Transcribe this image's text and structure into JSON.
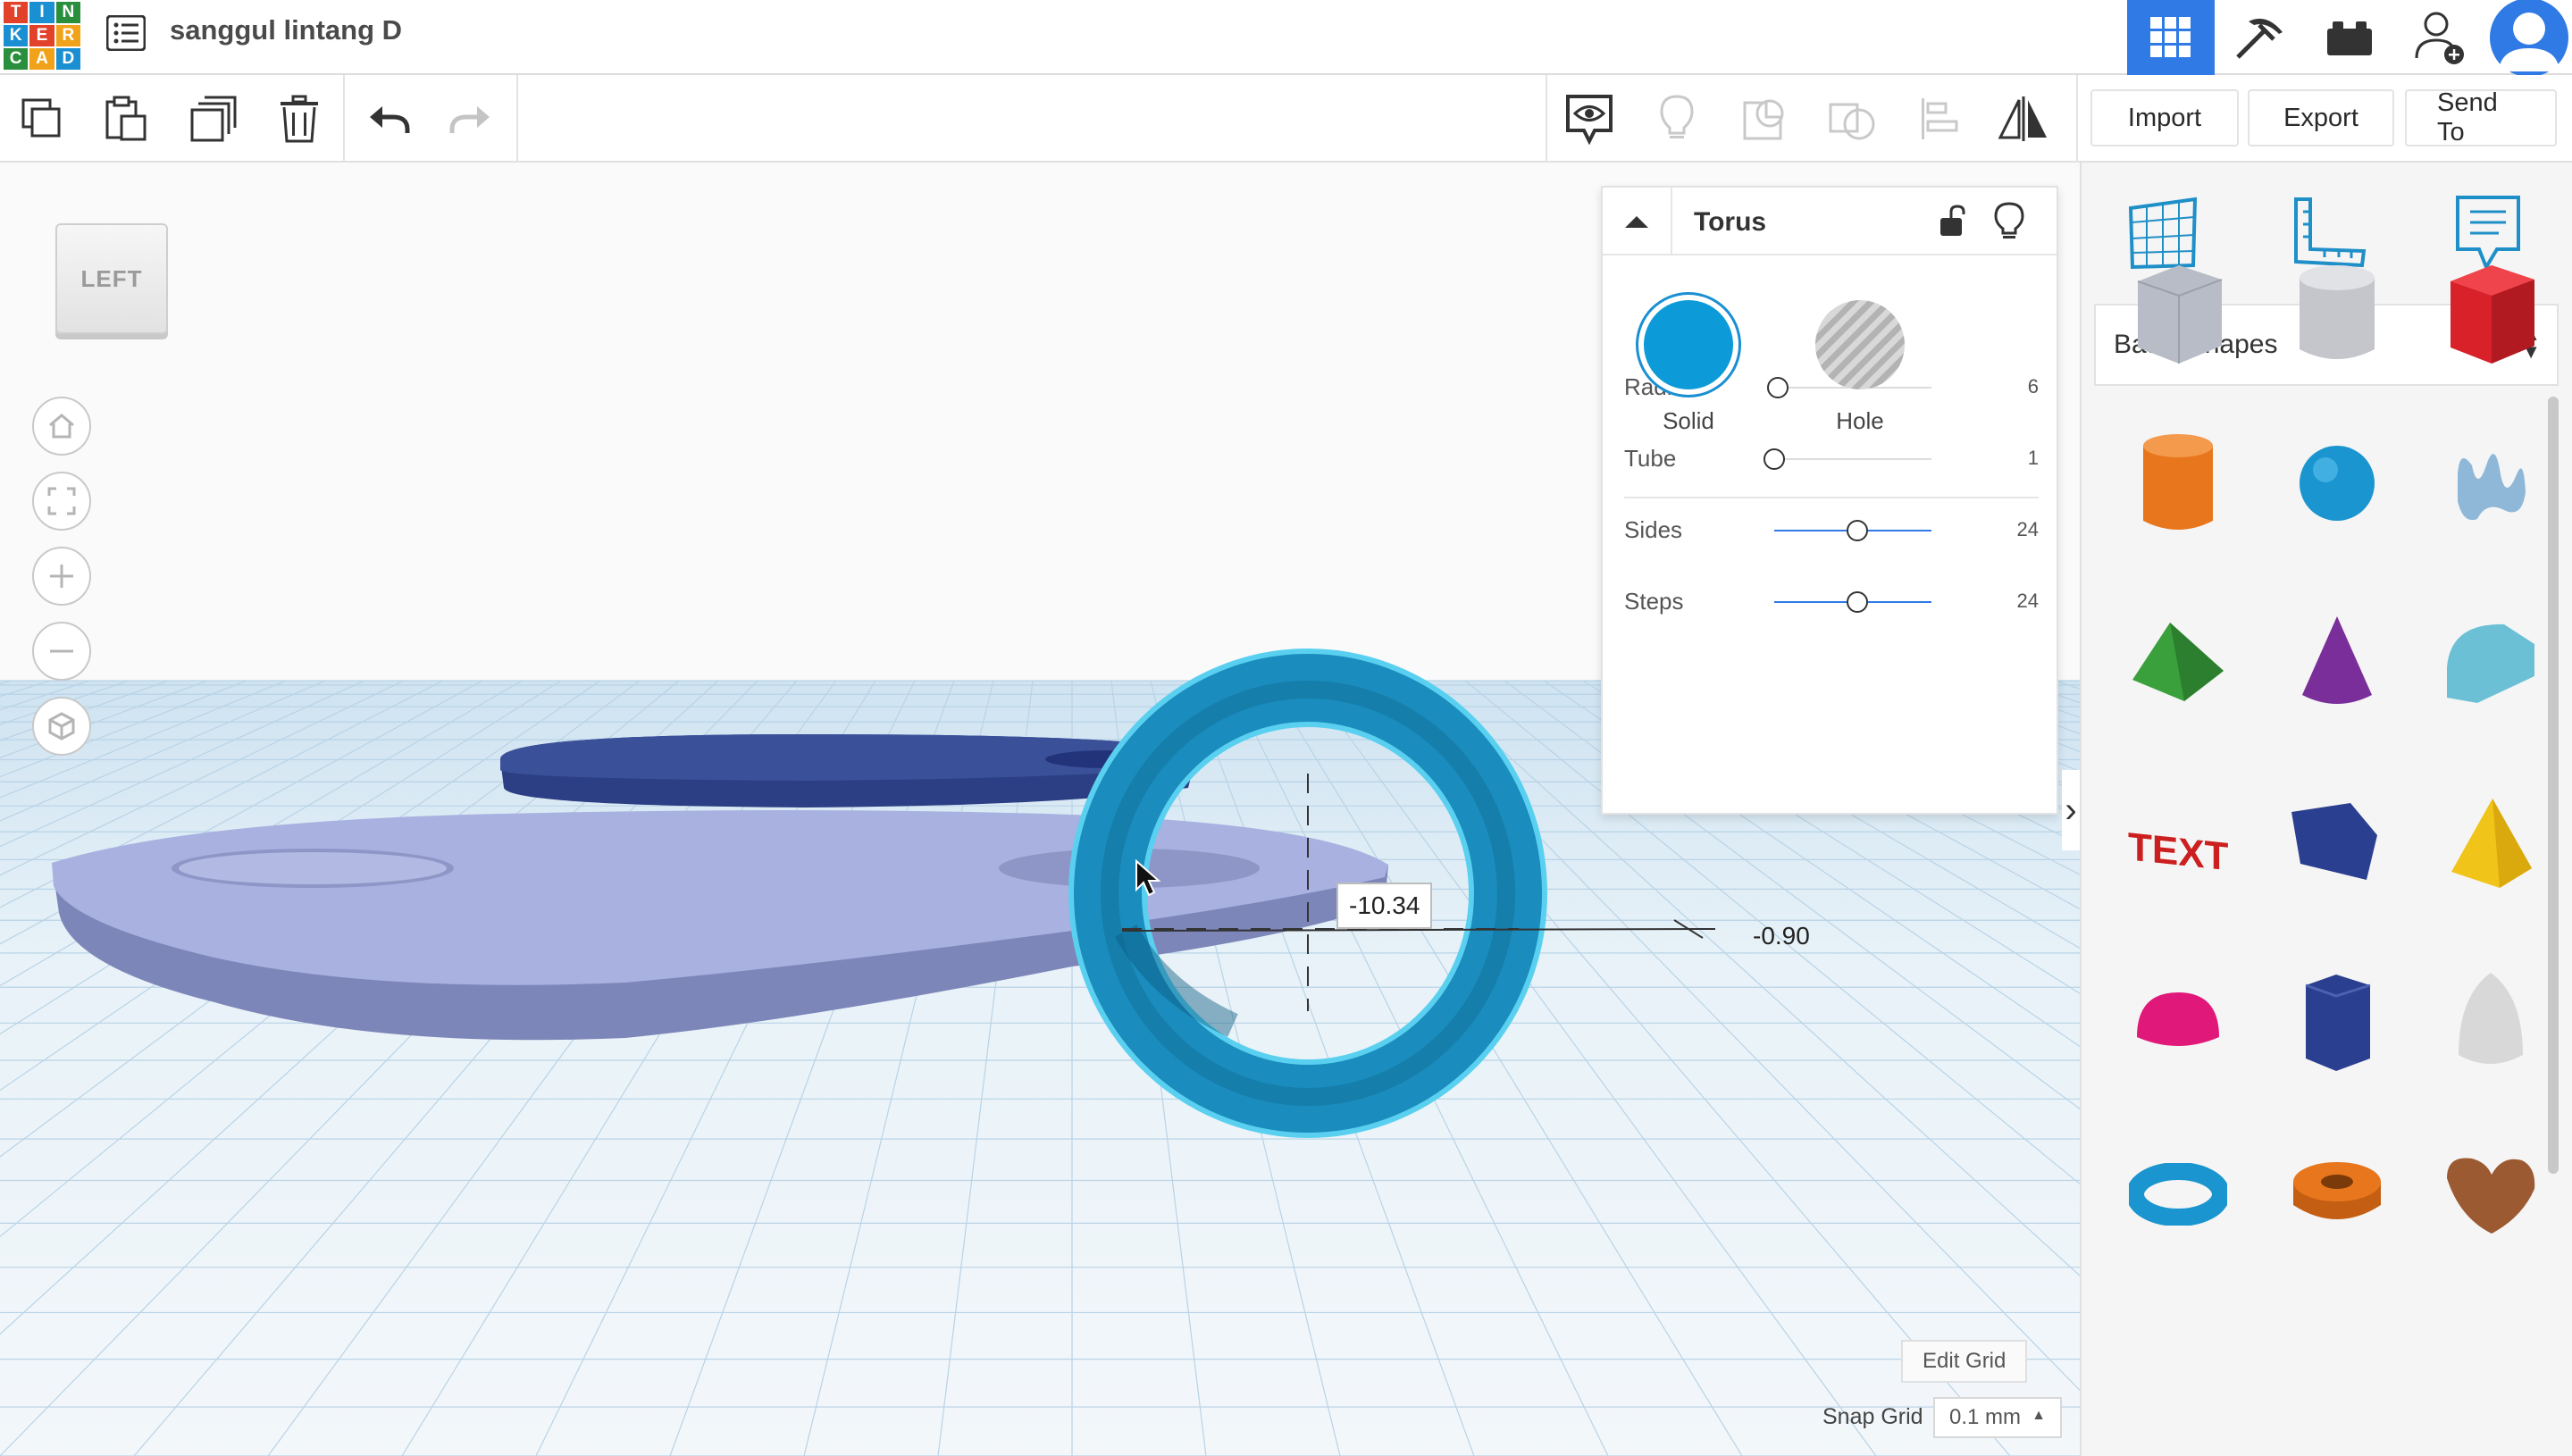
{
  "app": {
    "logo_letters": [
      "T",
      "I",
      "N",
      "K",
      "E",
      "R",
      "C",
      "A",
      "D"
    ],
    "logo_colors": [
      "#e2412a",
      "#1a8fd2",
      "#2a8f3c",
      "#1a8fd2",
      "#e2412a",
      "#f0a31a",
      "#2a8f3c",
      "#f0a31a",
      "#1a8fd2"
    ],
    "design_name": "sanggul lintang D",
    "accent_color": "#2f7ae5"
  },
  "top_icons": {
    "design_list": "list-icon",
    "view_3d": "grid-3d-icon",
    "codeblocks": "pickaxe-icon",
    "bricks": "brick-icon",
    "invite": "add-user-icon",
    "avatar": "user-avatar-icon"
  },
  "toolbar": {
    "tools": [
      "copy-icon",
      "paste-icon",
      "duplicate-icon",
      "trash-icon",
      "undo-icon",
      "redo-icon"
    ],
    "view_tools": [
      "notes-eye-icon",
      "bulb-icon",
      "group-icon",
      "ungroup-icon",
      "align-icon",
      "mirror-icon"
    ],
    "import_label": "Import",
    "export_label": "Export",
    "send_to_label": "Send To"
  },
  "viewport": {
    "view_cube_label": "LEFT",
    "nav": [
      "home-icon",
      "fit-view-icon",
      "zoom-in-icon",
      "zoom-out-icon",
      "perspective-icon"
    ],
    "dim_x": "-10.34",
    "dim_y": "-0.90"
  },
  "inspector": {
    "shape_name": "Torus",
    "solid_label": "Solid",
    "hole_label": "Hole",
    "solid_color": "#0c9bd8",
    "params": [
      {
        "label": "Radius",
        "value": "6",
        "fraction": 0.02,
        "active": false
      },
      {
        "label": "Tube",
        "value": "1",
        "fraction": 0.0,
        "active": false
      },
      {
        "label": "Sides",
        "value": "24",
        "fraction": 0.53,
        "active": true
      },
      {
        "label": "Steps",
        "value": "24",
        "fraction": 0.53,
        "active": true
      }
    ]
  },
  "grid_controls": {
    "edit_grid": "Edit Grid",
    "snap_grid_label": "Snap Grid",
    "snap_grid_value": "0.1 mm"
  },
  "right_panel": {
    "tabs": [
      "workplane-icon",
      "ruler-icon",
      "notes-icon"
    ],
    "category": "Basic Shapes",
    "shapes": [
      {
        "name": "box-hole-shape",
        "color": "#b8bcc6"
      },
      {
        "name": "cylinder-hole-shape",
        "color": "#c4c6cc"
      },
      {
        "name": "box-shape",
        "color": "#d9212a"
      },
      {
        "name": "cylinder-shape",
        "color": "#e8761c"
      },
      {
        "name": "sphere-shape",
        "color": "#1a95cf"
      },
      {
        "name": "scribble-shape",
        "color": "#8fb8d8"
      },
      {
        "name": "roof-shape",
        "color": "#3aa03c"
      },
      {
        "name": "cone-shape",
        "color": "#7a2e9a"
      },
      {
        "name": "round-roof-shape",
        "color": "#6cc0d6"
      },
      {
        "name": "text-shape",
        "color": "#cc1f1f"
      },
      {
        "name": "wedge-shape",
        "color": "#2a3f8f"
      },
      {
        "name": "pyramid-shape",
        "color": "#f0c419"
      },
      {
        "name": "half-sphere-shape",
        "color": "#e0187a"
      },
      {
        "name": "polygon-shape",
        "color": "#2a3f8f"
      },
      {
        "name": "paraboloid-shape",
        "color": "#d8d8d8"
      },
      {
        "name": "torus-shape",
        "color": "#1a95cf"
      },
      {
        "name": "tube-shape",
        "color": "#e8761c"
      },
      {
        "name": "heart-shape",
        "color": "#9c5a32"
      }
    ]
  }
}
